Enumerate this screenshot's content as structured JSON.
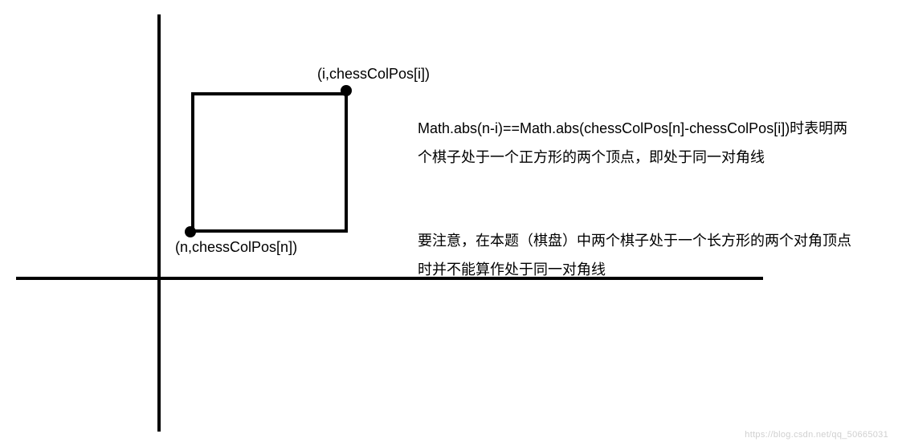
{
  "labels": {
    "top_point": "(i,chessColPos[i])",
    "bottom_point": "(n,chessColPos[n])"
  },
  "explanations": {
    "para1": "Math.abs(n-i)==Math.abs(chessColPos[n]-chessColPos[i])时表明两个棋子处于一个正方形的两个顶点，即处于同一对角线",
    "para2": "要注意，在本题（棋盘）中两个棋子处于一个长方形的两个对角顶点时并不能算作处于同一对角线"
  },
  "watermark": "https://blog.csdn.net/qq_50665031",
  "chart_data": {
    "type": "diagram",
    "description": "2D coordinate system with a square showing two diagonal corner points representing chess pieces",
    "axes": {
      "x_axis": {
        "visible": true,
        "label": ""
      },
      "y_axis": {
        "visible": true,
        "label": ""
      }
    },
    "shapes": [
      {
        "type": "square",
        "corners": [
          "top-right",
          "bottom-left"
        ],
        "stroke": "#000000"
      }
    ],
    "points": [
      {
        "name": "top-right",
        "label": "(i,chessColPos[i])"
      },
      {
        "name": "bottom-left",
        "label": "(n,chessColPos[n])"
      }
    ],
    "condition": "Math.abs(n-i) == Math.abs(chessColPos[n] - chessColPos[i])"
  }
}
